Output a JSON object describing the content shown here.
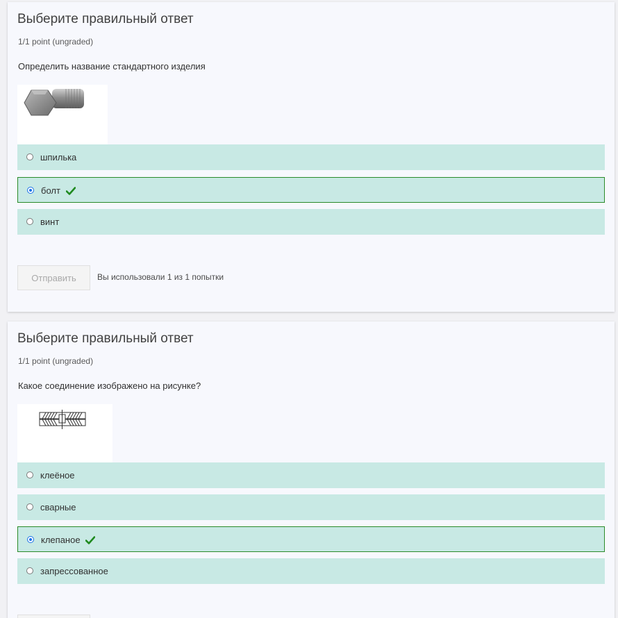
{
  "questions": [
    {
      "title": "Выберите правильный ответ",
      "points": "1/1 point (ungraded)",
      "text": "Определить название стандартного изделия",
      "image_icon": "hex-bolt-image",
      "choices": [
        {
          "label": "шпилька",
          "selected": false,
          "correct": false
        },
        {
          "label": "болт",
          "selected": true,
          "correct": true
        },
        {
          "label": "винт",
          "selected": false,
          "correct": false
        }
      ],
      "submit_label": "Отправить",
      "attempts_text": "Вы использовали 1 из 1 попытки"
    },
    {
      "title": "Выберите правильный ответ",
      "points": "1/1 point (ungraded)",
      "text": "Какое соединение изображено на рисунке?",
      "image_icon": "rivet-joint-image",
      "choices": [
        {
          "label": "клеёное",
          "selected": false,
          "correct": false
        },
        {
          "label": "сварные",
          "selected": false,
          "correct": false
        },
        {
          "label": "клепаное",
          "selected": true,
          "correct": true
        },
        {
          "label": "запрессованное",
          "selected": false,
          "correct": false
        }
      ],
      "submit_label": ""
    }
  ],
  "colors": {
    "choice_bg": "#c8e9e4",
    "correct_border": "#2a8a2a",
    "check_icon": "#1f8a1f",
    "radio_selected": "#1a73e8"
  }
}
